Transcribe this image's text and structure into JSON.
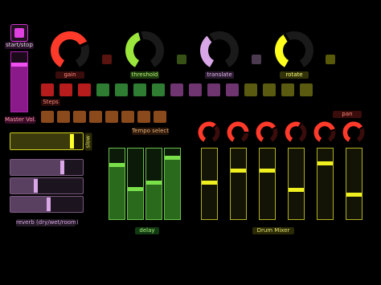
{
  "transport": {
    "start_label": "start/stop"
  },
  "master": {
    "label": "Master Vol.",
    "level": 0.82
  },
  "knobs": [
    {
      "id": "gain",
      "label": "gain",
      "color": "#ff3a2a",
      "value": 0.72
    },
    {
      "id": "threshold",
      "label": "threshold",
      "color": "#9be63c",
      "value": 0.45
    },
    {
      "id": "translate",
      "label": "translate",
      "color": "#d9a7e8",
      "value": 0.38
    },
    {
      "id": "rotate",
      "label": "rotate",
      "color": "#ffff1e",
      "value": 0.4
    }
  ],
  "steps": {
    "label": "Steps",
    "colors": [
      "#b71c1c",
      "#b71c1c",
      "#b71c1c",
      "#2e7d32",
      "#2e7d32",
      "#2e7d32",
      "#2e7d32",
      "#6e3570",
      "#6e3570",
      "#6e3570",
      "#6e3570",
      "#5a5a10",
      "#5a5a10",
      "#5a5a10",
      "#5a5a10"
    ]
  },
  "tempo": {
    "label": "Tempo select",
    "count": 8,
    "color": "#8b4a1c"
  },
  "slow": {
    "label": "slow",
    "value": 0.88
  },
  "reverb": {
    "label": "reverb (dry/wet/room)",
    "values": [
      0.74,
      0.38,
      0.55
    ]
  },
  "delay": {
    "label": "delay",
    "values": [
      0.8,
      0.45,
      0.55,
      0.9
    ]
  },
  "mixer": {
    "label": "Drum Mixer",
    "pan_label": "pan",
    "pans": [
      0.65,
      0.8,
      0.7,
      0.6,
      0.75,
      0.7
    ],
    "levels": [
      0.55,
      0.72,
      0.72,
      0.44,
      0.82,
      0.38
    ]
  }
}
